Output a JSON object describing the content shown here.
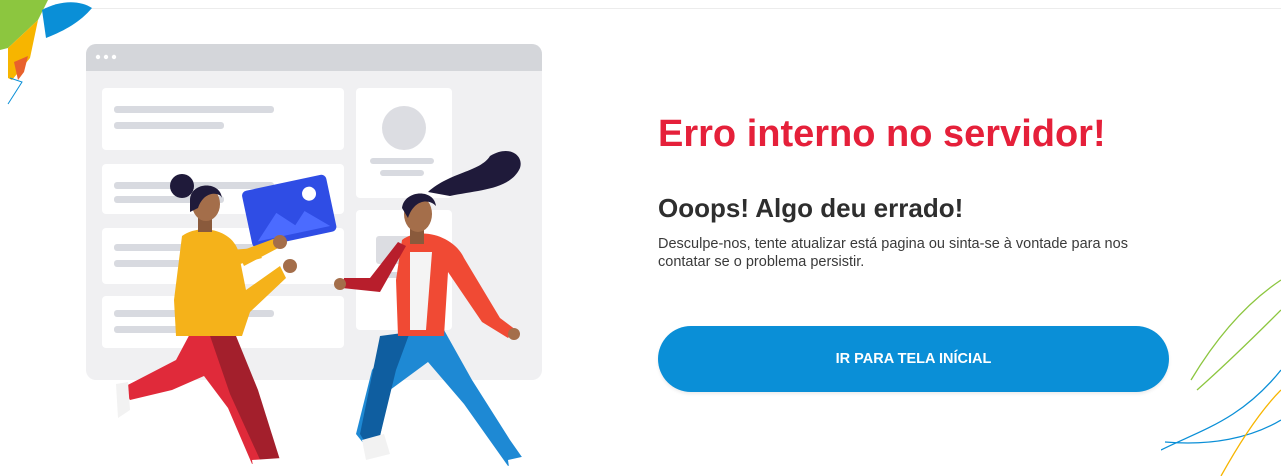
{
  "error": {
    "title": "Erro interno no servidor!",
    "subtitle": "Ooops! Algo deu errado!",
    "message": "Desculpe-nos, tente atualizar está pagina ou sinta-se à vontade para nos contatar se o problema persistir."
  },
  "actions": {
    "home_button_label": "IR PARA TELA INÍCIAL"
  },
  "colors": {
    "title": "#e5203a",
    "button": "#0a8fd7",
    "button_text": "#ffffff",
    "brand_green": "#8cc63f",
    "brand_yellow": "#f7b500",
    "brand_blue": "#0a8fd7"
  },
  "icons": [
    "brand-corner-shape",
    "error-illustration",
    "decorative-lines"
  ]
}
